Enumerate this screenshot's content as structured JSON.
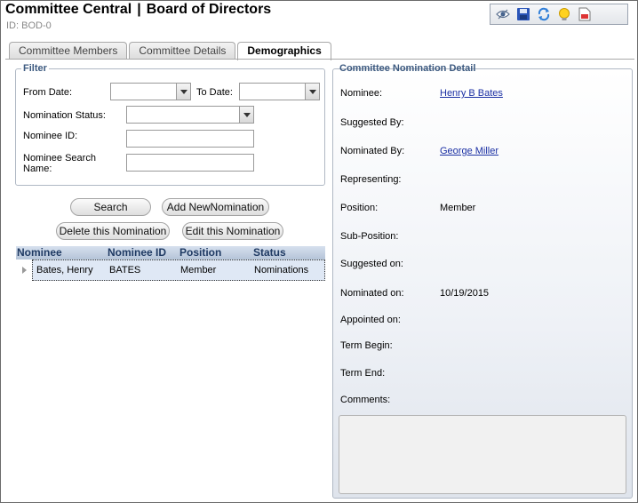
{
  "header": {
    "title_left": "Committee Central",
    "title_separator": "|",
    "title_right": "Board of Directors",
    "subtitle": "ID: BOD-0"
  },
  "toolbar": {
    "icons": [
      "view-icon",
      "save-icon",
      "refresh-icon",
      "lightbulb-icon",
      "report-icon"
    ]
  },
  "tabs": [
    {
      "label": "Committee Members",
      "active": false
    },
    {
      "label": "Committee Details",
      "active": false
    },
    {
      "label": "Demographics",
      "active": true
    }
  ],
  "filter": {
    "legend": "Filter",
    "from_date_label": "From Date:",
    "from_date_value": "",
    "to_date_label": "To Date:",
    "to_date_value": "",
    "nomination_status_label": "Nomination Status:",
    "nomination_status_value": "",
    "nominee_id_label": "Nominee ID:",
    "nominee_id_value": "",
    "nominee_search_label_1": "Nominee Search",
    "nominee_search_label_2": "Name:",
    "nominee_search_value": ""
  },
  "buttons": {
    "search": "Search",
    "add_new": "Add NewNomination",
    "delete": "Delete this Nomination",
    "edit": "Edit this Nomination"
  },
  "grid": {
    "columns": [
      "Nominee",
      "Nominee ID",
      "Position",
      "Status"
    ],
    "rows": [
      {
        "nominee": "Bates, Henry",
        "nominee_id": "BATES",
        "position": "Member",
        "status": "Nominations"
      }
    ]
  },
  "detail": {
    "legend": "Committee Nomination Detail",
    "nominee_label": "Nominee:",
    "nominee_value": "Henry B Bates",
    "suggested_by_label": "Suggested By:",
    "nominated_by_label": "Nominated By:",
    "nominated_by_value": "George Miller",
    "representing_label": "Representing:",
    "position_label": "Position:",
    "position_value": "Member",
    "sub_position_label": "Sub-Position:",
    "suggested_on_label": "Suggested on:",
    "nominated_on_label": "Nominated on:",
    "nominated_on_value": "10/19/2015",
    "appointed_on_label": "Appointed on:",
    "term_begin_label": "Term Begin:",
    "term_end_label": "Term End:",
    "comments_label": "Comments:",
    "comments_value": ""
  },
  "colors": {
    "legend_text": "#3d5a80",
    "grid_header_text": "#1f3a63",
    "link": "#1a2fa3",
    "row_selected": "#dfe8f5"
  }
}
